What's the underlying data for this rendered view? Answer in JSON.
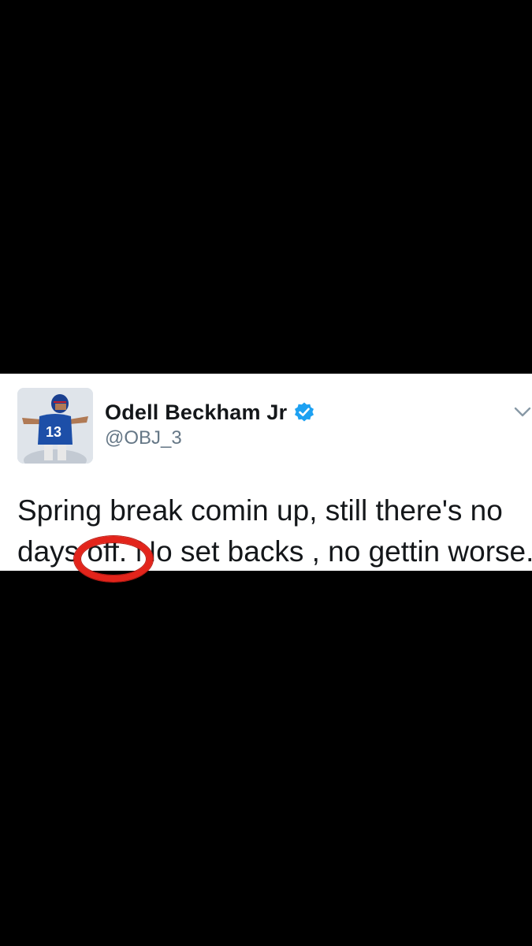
{
  "tweet": {
    "display_name": "Odell Beckham Jr",
    "handle": "@OBJ_3",
    "verified": true,
    "text_line_1": "Spring break comin up, still there's no",
    "text_line_2": "days off. No set backs , no gettin worse.",
    "jersey_number": "13",
    "verified_icon": "verified-badge-icon",
    "menu_icon": "chevron-down-icon"
  },
  "colors": {
    "background": "#000000",
    "card": "#ffffff",
    "verified_blue": "#1da1f2",
    "highlight_red": "#e3241b",
    "handle_gray": "#657786"
  }
}
